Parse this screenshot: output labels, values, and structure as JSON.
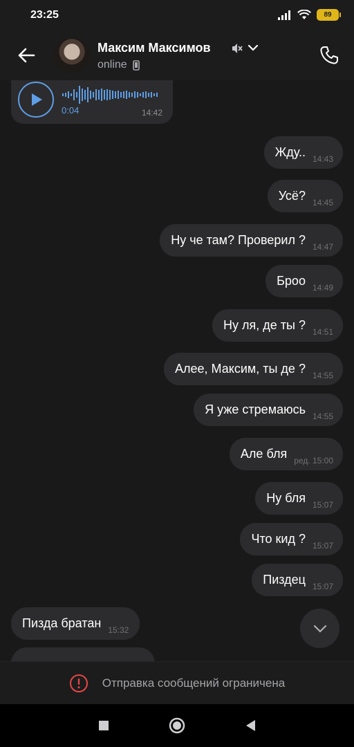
{
  "status_bar": {
    "time": "23:25",
    "battery": "89"
  },
  "header": {
    "contact_name": "Максим Максимов",
    "status": "online"
  },
  "voice_message": {
    "duration": "0:04",
    "time": "14:42"
  },
  "messages": [
    {
      "direction": "out",
      "text": "Жду..",
      "time": "14:43"
    },
    {
      "direction": "out",
      "text": "Усё?",
      "time": "14:45"
    },
    {
      "direction": "out",
      "text": "Ну че там? Проверил ?",
      "time": "14:47"
    },
    {
      "direction": "out",
      "text": "Броо",
      "time": "14:49"
    },
    {
      "direction": "out",
      "text": "Ну ля, де ты ?",
      "time": "14:51"
    },
    {
      "direction": "out",
      "text": "Алее, Максим, ты де ?",
      "time": "14:55"
    },
    {
      "direction": "out",
      "text": "Я уже стремаюсь",
      "time": "14:55"
    },
    {
      "direction": "out",
      "text": "Але бля",
      "time": "ред. 15:00"
    },
    {
      "direction": "out",
      "text": "Ну бля",
      "time": "15:07"
    },
    {
      "direction": "out",
      "text": "Что кид ?",
      "time": "15:07"
    },
    {
      "direction": "out",
      "text": "Пиздец",
      "time": "15:07"
    },
    {
      "direction": "in",
      "text": "Пизда братан",
      "time": "15:32"
    }
  ],
  "footer": {
    "restricted_text": "Отправка сообщений ограничена"
  },
  "colors": {
    "background": "#19191a",
    "bubble": "#2c2c2e",
    "accent": "#5f9ee6",
    "warning": "#e64646",
    "battery": "#e0b51a"
  },
  "icons": {
    "back": "arrow-left-icon",
    "mute": "muted-speaker-icon",
    "chevron": "chevron-down-icon",
    "device": "phone-device-icon",
    "call": "phone-call-icon",
    "play": "play-icon",
    "scroll_down": "chevron-down-icon",
    "warning": "exclamation-circle-icon",
    "nav_recents": "square-icon",
    "nav_home": "circle-icon",
    "nav_back": "triangle-back-icon"
  }
}
